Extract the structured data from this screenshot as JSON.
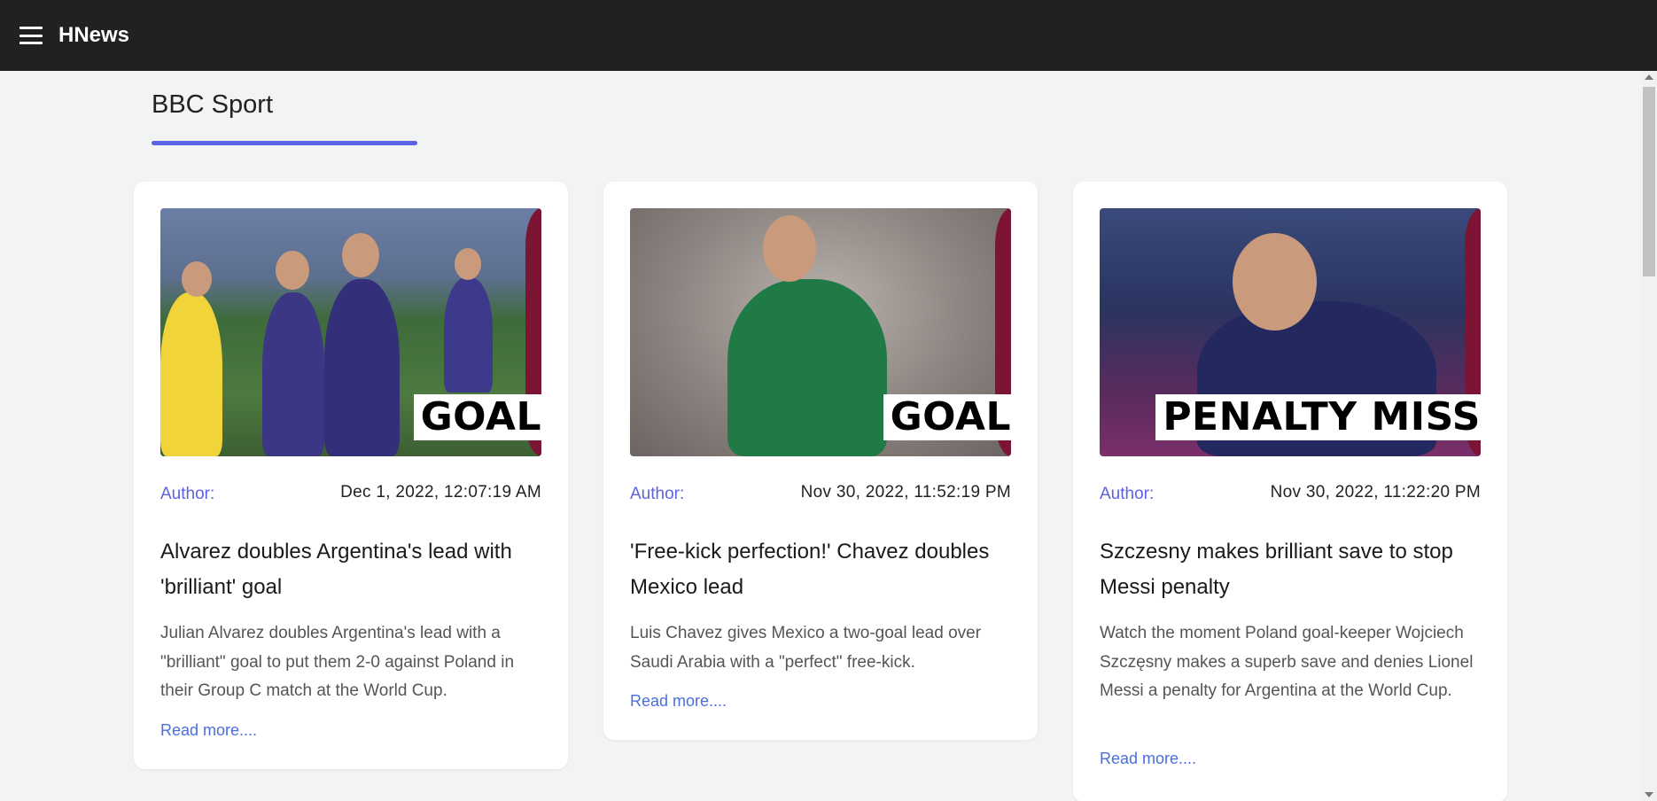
{
  "header": {
    "app_name": "HNews",
    "menu_icon": "hamburger-menu-icon",
    "background": "#212121"
  },
  "section": {
    "title": "BBC Sport",
    "accent_color": "#5b63e4"
  },
  "articles": [
    {
      "image_banner": "GOAL",
      "author_label": "Author:",
      "date": "Dec 1, 2022, 12:07:19 AM",
      "title": "Alvarez doubles Argentina's lead with 'brilliant' goal",
      "description": "Julian Alvarez doubles Argentina's lead with a \"brilliant\" goal to put them 2-0 against Poland in their Group C match at the World Cup.",
      "read_more": "Read more...."
    },
    {
      "image_banner": "GOAL",
      "author_label": "Author:",
      "date": "Nov 30, 2022, 11:52:19 PM",
      "title": "'Free-kick perfection!' Chavez doubles Mexico lead",
      "description": "Luis Chavez gives Mexico a two-goal lead over Saudi Arabia with a \"perfect\" free-kick.",
      "read_more": "Read more...."
    },
    {
      "image_banner": "PENALTY MISS",
      "author_label": "Author:",
      "date": "Nov 30, 2022, 11:22:20 PM",
      "title": "Szczesny makes brilliant save to stop Messi penalty",
      "description": "Watch the moment Poland goal-keeper Wojciech Szczęsny makes a superb save and denies Lionel Messi a penalty for Argentina at the World Cup.",
      "read_more": "Read more...."
    }
  ],
  "colors": {
    "link": "#4a6ee0",
    "author": "#5b63e4",
    "page_background": "#f2f3f5"
  }
}
